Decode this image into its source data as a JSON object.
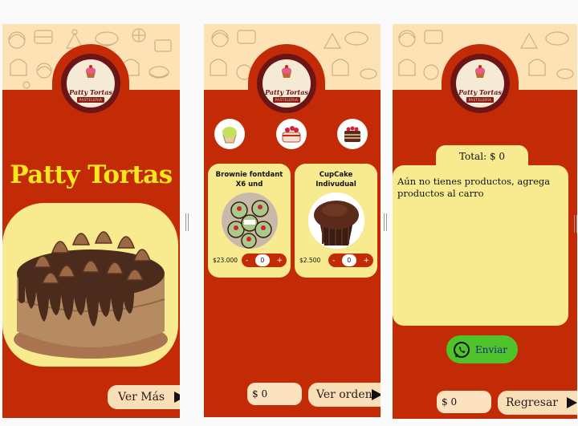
{
  "brand": {
    "logo_name": "Patty Tortas",
    "logo_ribbon": "PASTELERIA"
  },
  "home": {
    "title": "Patty Tortas",
    "ver_mas_label": "Ver Más"
  },
  "catalog": {
    "categories": [
      {
        "icon": "green-cupcake-icon"
      },
      {
        "icon": "strawberry-cake-icon"
      },
      {
        "icon": "layer-cake-icon"
      }
    ],
    "products": [
      {
        "name": "Brownie fontdant X6 und",
        "price": "$23.000",
        "qty": "0"
      },
      {
        "name": "CupCake Indivudual",
        "price": "$2.500",
        "qty": "0"
      }
    ],
    "total": "$ 0",
    "ver_orden_label": "Ver orden"
  },
  "cart": {
    "total_label": "Total: $ 0",
    "empty_message": "Aún no tienes productos, agrega productos al carro",
    "enviar_label": "Enviar",
    "total": "$ 0",
    "regresar_label": "Regresar"
  },
  "colors": {
    "panel_red": "#c22b06",
    "card_yellow": "#f8ea8e",
    "title_yellow": "#f6e61e",
    "button_cream": "#f9dfb8",
    "whatsapp_green": "#4ec42a"
  }
}
